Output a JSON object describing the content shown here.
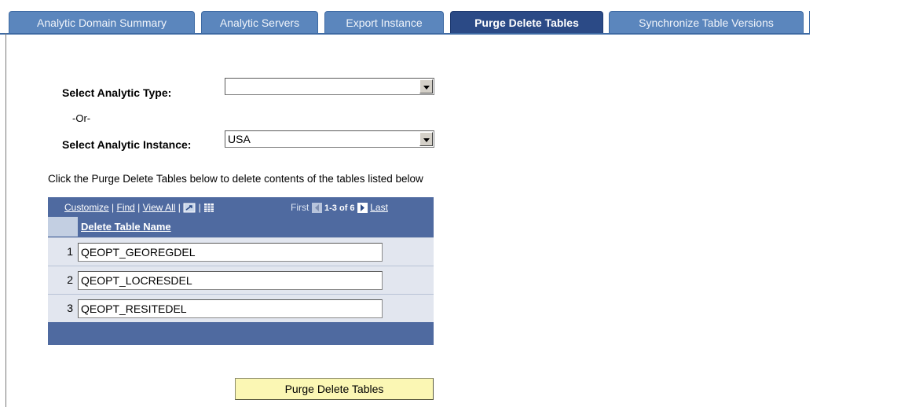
{
  "tabs": [
    {
      "label": "Analytic Domain Summary"
    },
    {
      "label": "Analytic Servers"
    },
    {
      "label": "Export Instance"
    },
    {
      "label": "Purge Delete Tables"
    },
    {
      "label": "Synchronize Table Versions"
    }
  ],
  "form": {
    "analytic_type_label": "Select Analytic Type:",
    "analytic_type_value": "",
    "or_text": "-Or-",
    "analytic_instance_label": "Select Analytic Instance:",
    "analytic_instance_value": "USA"
  },
  "instructions": "Click the Purge Delete Tables below to delete contents  of the tables listed below",
  "grid": {
    "customize": "Customize",
    "find": "Find",
    "view_all": "View All",
    "first": "First",
    "range": "1-3 of 6",
    "last": "Last",
    "column_header": "Delete Table Name",
    "rows": [
      {
        "num": "1",
        "value": "QEOPT_GEOREGDEL"
      },
      {
        "num": "2",
        "value": "QEOPT_LOCRESDEL"
      },
      {
        "num": "3",
        "value": "QEOPT_RESITEDEL"
      }
    ]
  },
  "button_label": "Purge Delete Tables",
  "colors": {
    "tab": "#5b86bd",
    "tab_active": "#2b4a86",
    "grid_header": "#4f6aa0",
    "button": "#fbf7b4"
  }
}
